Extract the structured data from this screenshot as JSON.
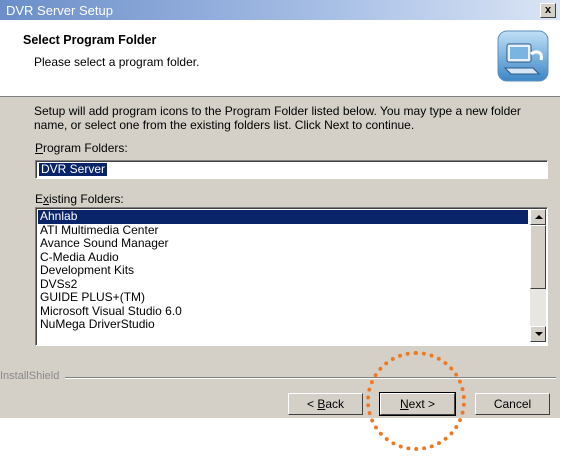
{
  "window": {
    "title": "DVR Server Setup",
    "close_label": "x"
  },
  "header": {
    "title": "Select Program Folder",
    "subtitle": "Please select a program folder.",
    "icon": "setup-computer-icon"
  },
  "description": "Setup will add program icons to the Program Folder listed below.  You may type a new folder name, or select one from the existing folders list.  Click Next to continue.",
  "program_folders": {
    "label_prefix": "P",
    "label_rest": "rogram Folders:",
    "value": "DVR Server"
  },
  "existing_folders": {
    "label_prefix": "E",
    "label_mnemonic": "x",
    "label_rest": "isting Folders:",
    "items": [
      "Ahnlab",
      "ATI Multimedia Center",
      "Avance Sound Manager",
      "C-Media Audio",
      "Development Kits",
      "DVSs2",
      "GUIDE PLUS+(TM)",
      "Microsoft Visual Studio 6.0",
      "NuMega DriverStudio"
    ],
    "selected": "Ahnlab"
  },
  "footer": {
    "brand": "InstallShield",
    "back_prefix": "< ",
    "back_mnemonic": "B",
    "back_rest": "ack",
    "next_mnemonic": "N",
    "next_rest": "ext >",
    "cancel": "Cancel"
  },
  "colors": {
    "selection": "#0a246a",
    "highlight_circle": "#f07820",
    "dialog_face": "#d4d0c8"
  }
}
